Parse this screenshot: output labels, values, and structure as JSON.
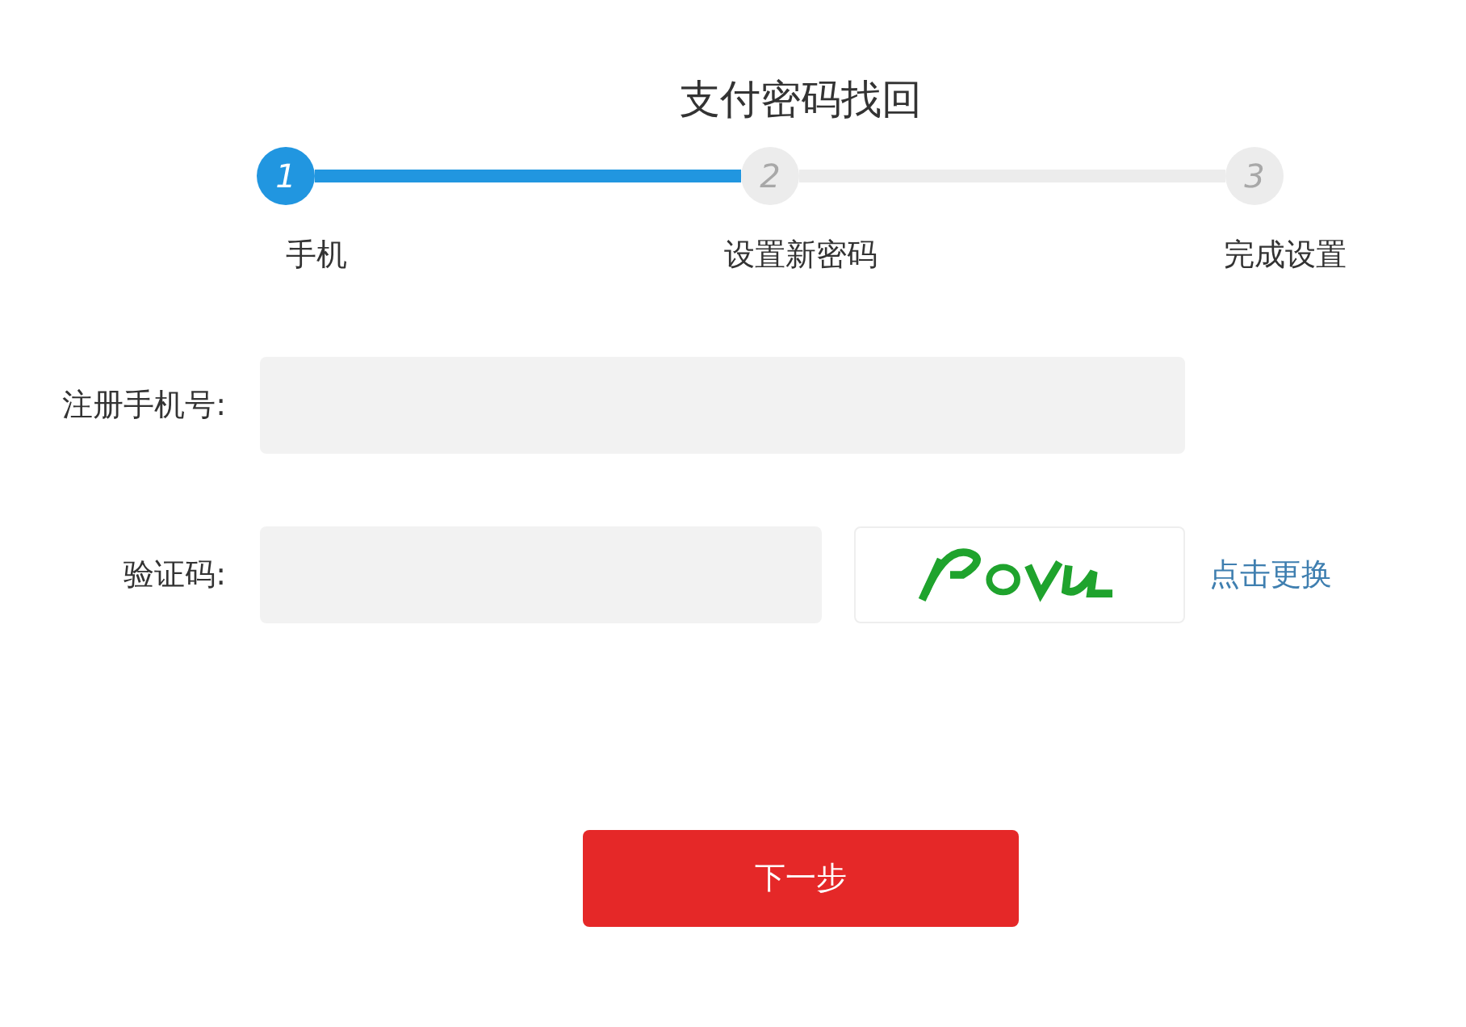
{
  "title": "支付密码找回",
  "steps": [
    {
      "number": "1",
      "label": "手机",
      "selected": true
    },
    {
      "number": "2",
      "label": "设置新密码",
      "selected": false
    },
    {
      "number": "3",
      "label": "完成设置",
      "selected": false
    }
  ],
  "form": {
    "phone": {
      "label": "注册手机号:"
    },
    "code": {
      "label": "验证码:"
    },
    "refresh_link": "点击更换"
  },
  "next_button": "下一步"
}
